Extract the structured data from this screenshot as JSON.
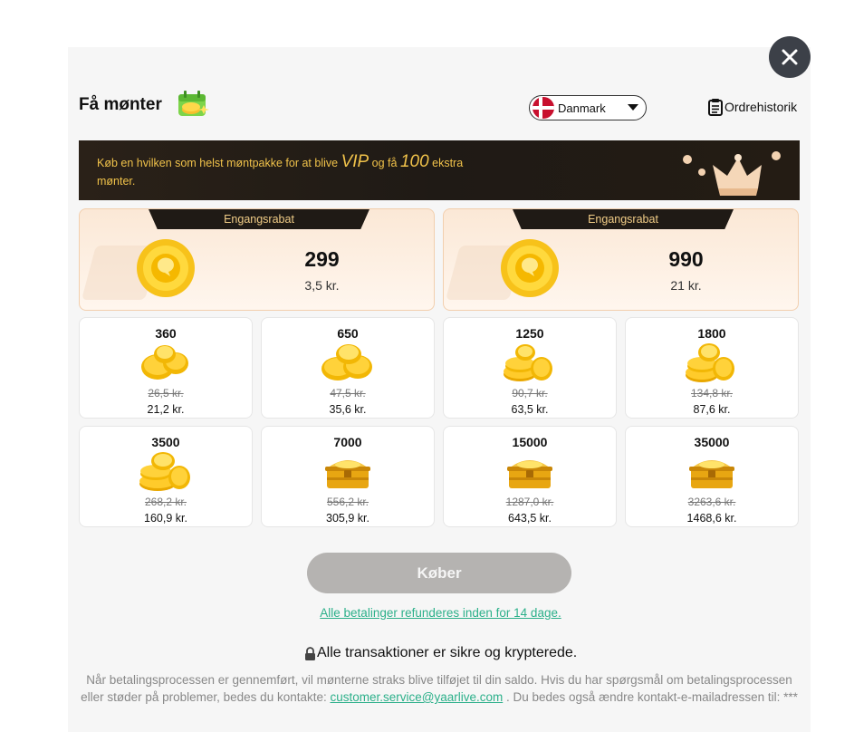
{
  "header": {
    "title": "Få mønter",
    "country": "Danmark",
    "order_history": "Ordrehistorik"
  },
  "banner": {
    "text_part1": "Køb en hvilken som helst møntpakke for at blive ",
    "vip": "VIP",
    "text_part2": " og få ",
    "bonus": "100",
    "text_part3": " ekstra mønter."
  },
  "featured": [
    {
      "ribbon": "Engangsrabat",
      "amount": "299",
      "price": "3,5 kr."
    },
    {
      "ribbon": "Engangsrabat",
      "amount": "990",
      "price": "21 kr."
    }
  ],
  "packages": [
    {
      "amount": "360",
      "old_price": "26,5 kr.",
      "price": "21,2 kr.",
      "icon": "coins-small-icon"
    },
    {
      "amount": "650",
      "old_price": "47,5 kr.",
      "price": "35,6 kr.",
      "icon": "coins-small-icon"
    },
    {
      "amount": "1250",
      "old_price": "90,7 kr.",
      "price": "63,5 kr.",
      "icon": "coin-pile-icon"
    },
    {
      "amount": "1800",
      "old_price": "134,8 kr.",
      "price": "87,6 kr.",
      "icon": "coin-pile-icon"
    },
    {
      "amount": "3500",
      "old_price": "268,2 kr.",
      "price": "160,9 kr.",
      "icon": "coin-pile-icon"
    },
    {
      "amount": "7000",
      "old_price": "556,2 kr.",
      "price": "305,9 kr.",
      "icon": "treasure-chest-icon"
    },
    {
      "amount": "15000",
      "old_price": "1287,0 kr.",
      "price": "643,5 kr.",
      "icon": "treasure-chest-icon"
    },
    {
      "amount": "35000",
      "old_price": "3263,6 kr.",
      "price": "1468,6 kr.",
      "icon": "treasure-chest-icon"
    }
  ],
  "buy_label": "Køber",
  "refund_link": "Alle betalinger refunderes inden for 14 dage.",
  "secure_text": "Alle transaktioner er sikre og krypterede.",
  "info": {
    "text1": "Når betalingsprocessen er gennemført, vil mønterne straks blive tilføjet til din saldo. Hvis du har spørgsmål om betalingsprocessen eller støder på problemer, bedes du kontakte: ",
    "email": "customer.service@yaarlive.com",
    "text2": " . Du bedes også ændre kontakt-e-mailadressen til: ***"
  },
  "colors": {
    "accent_green": "#2cb08a",
    "gold": "#f0c24a",
    "button_disabled": "#b5b3b1"
  }
}
